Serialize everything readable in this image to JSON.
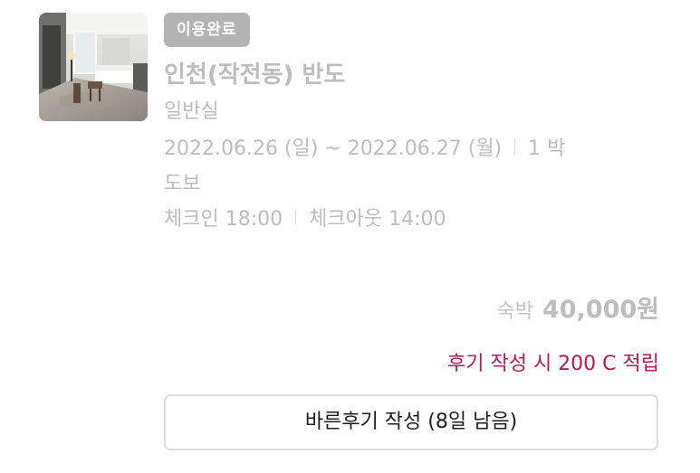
{
  "booking": {
    "status_badge": "이용완료",
    "title": "인천(작전동) 반도",
    "room_type": "일반실",
    "date_range": "2022.06.26 (일) ~ 2022.06.27 (월)",
    "nights": "1 박",
    "transport": "도보",
    "check_in": "체크인 18:00",
    "check_out": "체크아웃 14:00",
    "thumbnail_icon": "room-photo"
  },
  "price": {
    "label": "숙박",
    "amount": "40,000원"
  },
  "reward": {
    "text": "후기 작성 시 200 C 적립",
    "color": "#b8195a"
  },
  "review_button": {
    "label": "바른후기 작성 (8일 남음)"
  },
  "colors": {
    "badge_bg": "#b3b3b3",
    "muted_text": "#bdbdbd",
    "accent": "#b8195a"
  }
}
